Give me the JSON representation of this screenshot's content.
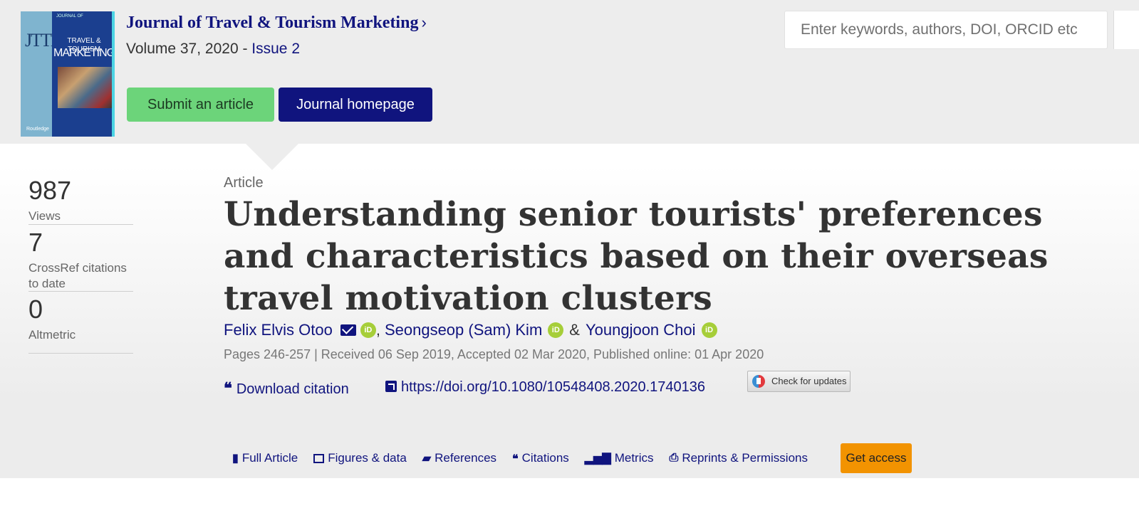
{
  "journal": {
    "cover": {
      "top_text": "JOURNAL OF",
      "title_line": "TRAVEL & TOURISM",
      "title_big": "MARKETING",
      "logo_letters": "JTTM",
      "publisher": "Routledge"
    },
    "title": "Journal of Travel & Tourism Marketing",
    "title_chevron": "›",
    "volume_text": "Volume 37, 2020 - ",
    "issue_link": "Issue 2",
    "submit_label": "Submit an article",
    "homepage_label": "Journal homepage"
  },
  "search": {
    "placeholder": "Enter keywords, authors, DOI, ORCID etc"
  },
  "metrics": [
    {
      "value": "987",
      "label": "Views"
    },
    {
      "value": "7",
      "label": "CrossRef citations to date"
    },
    {
      "value": "0",
      "label": "Altmetric"
    }
  ],
  "article": {
    "kind": "Article",
    "title_lines": [
      "Understanding senior tourists' preferences",
      "and characteristics based on their overseas",
      "travel motivation clusters"
    ],
    "authors": [
      {
        "name": "Felix Elvis Otoo",
        "sep_after": ","
      },
      {
        "name": "Seongseop (Sam) Kim",
        "sep_after": "&"
      },
      {
        "name": "Youngjoon Choi",
        "sep_after": ""
      }
    ],
    "orcid_glyph": "iD",
    "pages_line": "Pages 246-257 | Received 06 Sep 2019, Accepted 02 Mar 2020, Published online: 01 Apr 2020",
    "download_citation": "Download citation",
    "doi": "https://doi.org/10.1080/10548408.2020.1740136",
    "check_updates": "Check for updates"
  },
  "tabs": [
    {
      "label": "Full Article",
      "icon": "file-icon"
    },
    {
      "label": "Figures & data",
      "icon": "image-icon"
    },
    {
      "label": "References",
      "icon": "book-icon"
    },
    {
      "label": "Citations",
      "icon": "quote-icon"
    },
    {
      "label": "Metrics",
      "icon": "bar-chart-icon"
    },
    {
      "label": "Reprints & Permissions",
      "icon": "print-icon"
    }
  ],
  "get_access": "Get access",
  "colors": {
    "brand_navy": "#10147e",
    "submit_green": "#6cd47a",
    "access_orange": "#f29301",
    "orcid_green": "#a6ce39"
  }
}
